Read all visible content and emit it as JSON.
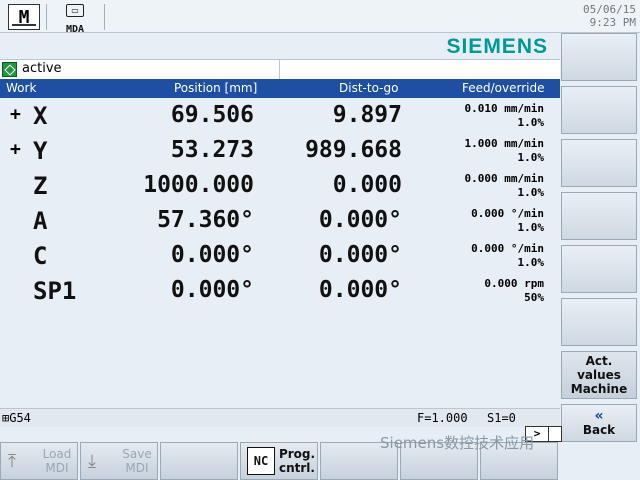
{
  "topbar": {
    "mode_icon": "M",
    "mda_label": "MDA",
    "date": "05/06/15",
    "time": "9:23 PM"
  },
  "brand": "SIEMENS",
  "status": {
    "text": "active",
    "icon": "status-active-icon"
  },
  "table": {
    "headers": {
      "work": "Work",
      "position": "Position [mm]",
      "dist": "Dist-to-go",
      "feed": "Feed/override"
    },
    "rows": [
      {
        "sign": "+",
        "axis": "X",
        "position": "69.506",
        "dist": "9.897",
        "feed": "0.010 mm/min",
        "override": "1.0%"
      },
      {
        "sign": "+",
        "axis": "Y",
        "position": "53.273",
        "dist": "989.668",
        "feed": "1.000 mm/min",
        "override": "1.0%"
      },
      {
        "sign": "",
        "axis": "Z",
        "position": "1000.000",
        "dist": "0.000",
        "feed": "0.000 mm/min",
        "override": "1.0%"
      },
      {
        "sign": "",
        "axis": "A",
        "position": "57.360°",
        "dist": "0.000°",
        "feed": "0.000 °/min",
        "override": "1.0%"
      },
      {
        "sign": "",
        "axis": "C",
        "position": "0.000°",
        "dist": "0.000°",
        "feed": "0.000 °/min",
        "override": "1.0%"
      },
      {
        "sign": "",
        "axis": "SP1",
        "position": "0.000°",
        "dist": "0.000°",
        "feed": "0.000 rpm",
        "override": "50%"
      }
    ]
  },
  "bottom_status": {
    "wcs": "G54",
    "feed": "F=1.000",
    "spindle": "S1=0",
    "scroll": ">"
  },
  "right_softkeys": {
    "act_values": "Act. values Machine",
    "back": "Back",
    "back_icon": "«"
  },
  "bottom_softkeys": {
    "load": "Load MDI",
    "save": "Save MDI",
    "prog": "Prog. cntrl.",
    "prog_icon": "NC"
  },
  "watermark": "Siemens数控技术应用"
}
